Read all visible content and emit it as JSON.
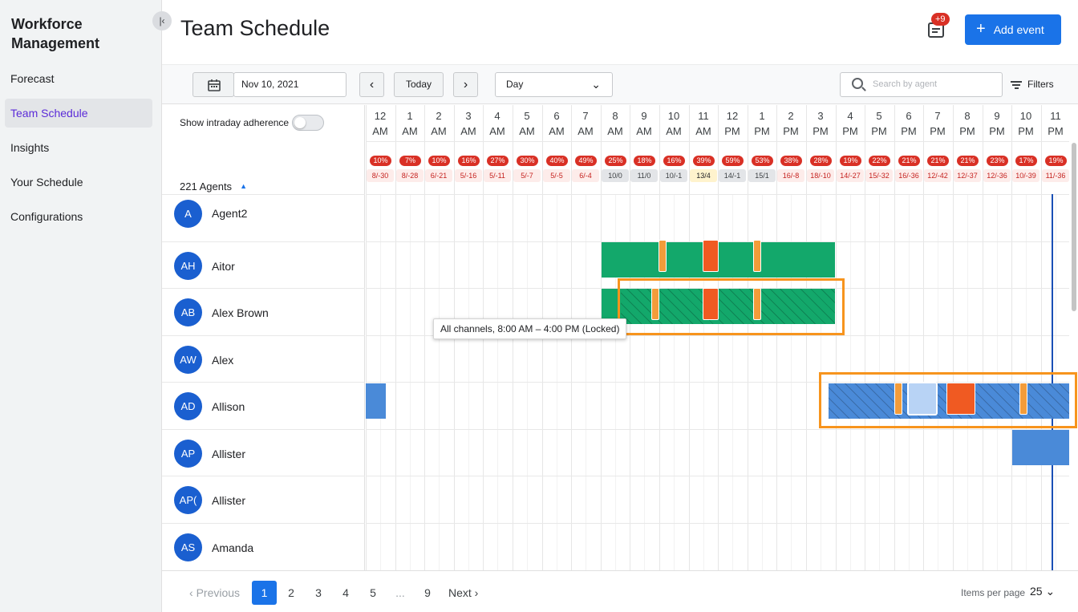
{
  "app_title": "Workforce Management",
  "nav": [
    {
      "label": "Forecast",
      "active": false
    },
    {
      "label": "Team Schedule",
      "active": true
    },
    {
      "label": "Insights",
      "active": false
    },
    {
      "label": "Your Schedule",
      "active": false
    },
    {
      "label": "Configurations",
      "active": false
    }
  ],
  "page_title": "Team Schedule",
  "notification_count": "+9",
  "add_event_label": "Add event",
  "toolbar": {
    "date": "Nov 10, 2021",
    "today_label": "Today",
    "view": "Day",
    "search_placeholder": "Search by agent",
    "filters_label": "Filters"
  },
  "adherence_label": "Show intraday adherence",
  "adherence_on": false,
  "agent_count": "221 Agents",
  "hours": [
    {
      "h": "12",
      "p": "AM",
      "pct": "10%",
      "ratio": "8/-30"
    },
    {
      "h": "1",
      "p": "AM",
      "pct": "7%",
      "ratio": "8/-28"
    },
    {
      "h": "2",
      "p": "AM",
      "pct": "10%",
      "ratio": "6/-21"
    },
    {
      "h": "3",
      "p": "AM",
      "pct": "16%",
      "ratio": "5/-16"
    },
    {
      "h": "4",
      "p": "AM",
      "pct": "27%",
      "ratio": "5/-11"
    },
    {
      "h": "5",
      "p": "AM",
      "pct": "30%",
      "ratio": "5/-7"
    },
    {
      "h": "6",
      "p": "AM",
      "pct": "40%",
      "ratio": "5/-5"
    },
    {
      "h": "7",
      "p": "AM",
      "pct": "49%",
      "ratio": "6/-4"
    },
    {
      "h": "8",
      "p": "AM",
      "pct": "25%",
      "ratio": "10/0"
    },
    {
      "h": "9",
      "p": "AM",
      "pct": "18%",
      "ratio": "11/0"
    },
    {
      "h": "10",
      "p": "AM",
      "pct": "16%",
      "ratio": "10/-1"
    },
    {
      "h": "11",
      "p": "AM",
      "pct": "39%",
      "ratio": "13/4"
    },
    {
      "h": "12",
      "p": "PM",
      "pct": "59%",
      "ratio": "14/-1"
    },
    {
      "h": "1",
      "p": "PM",
      "pct": "53%",
      "ratio": "15/1"
    },
    {
      "h": "2",
      "p": "PM",
      "pct": "38%",
      "ratio": "16/-8"
    },
    {
      "h": "3",
      "p": "PM",
      "pct": "28%",
      "ratio": "18/-10"
    },
    {
      "h": "4",
      "p": "PM",
      "pct": "19%",
      "ratio": "14/-27"
    },
    {
      "h": "5",
      "p": "PM",
      "pct": "22%",
      "ratio": "15/-32"
    },
    {
      "h": "6",
      "p": "PM",
      "pct": "21%",
      "ratio": "16/-36"
    },
    {
      "h": "7",
      "p": "PM",
      "pct": "21%",
      "ratio": "12/-42"
    },
    {
      "h": "8",
      "p": "PM",
      "pct": "21%",
      "ratio": "12/-37"
    },
    {
      "h": "9",
      "p": "PM",
      "pct": "23%",
      "ratio": "12/-36"
    },
    {
      "h": "10",
      "p": "PM",
      "pct": "17%",
      "ratio": "10/-39"
    },
    {
      "h": "11",
      "p": "PM",
      "pct": "19%",
      "ratio": "11/-36"
    }
  ],
  "agents": [
    {
      "initials": "A",
      "name": "Agent2"
    },
    {
      "initials": "AH",
      "name": "Aitor"
    },
    {
      "initials": "AB",
      "name": "Alex Brown"
    },
    {
      "initials": "AW",
      "name": "Alex"
    },
    {
      "initials": "AD",
      "name": "Allison"
    },
    {
      "initials": "AP",
      "name": "Allister"
    },
    {
      "initials": "AP(",
      "name": "Allister"
    },
    {
      "initials": "AS",
      "name": "Amanda"
    }
  ],
  "tooltip": "All channels, 8:00 AM – 4:00 PM (Locked)",
  "pagination": {
    "previous": "Previous",
    "pages": [
      "1",
      "2",
      "3",
      "4",
      "5",
      "...",
      "9"
    ],
    "current": "1",
    "next": "Next",
    "items_per_page_label": "Items per page",
    "items_per_page": "25"
  },
  "colors": {
    "accent": "#1a73e8",
    "shift_green": "#13a86b",
    "shift_blue": "#4a8ad8",
    "break": "#f39c3a",
    "lunch": "#f05a22",
    "highlight": "#f7941d",
    "badge_red": "#d93025"
  }
}
